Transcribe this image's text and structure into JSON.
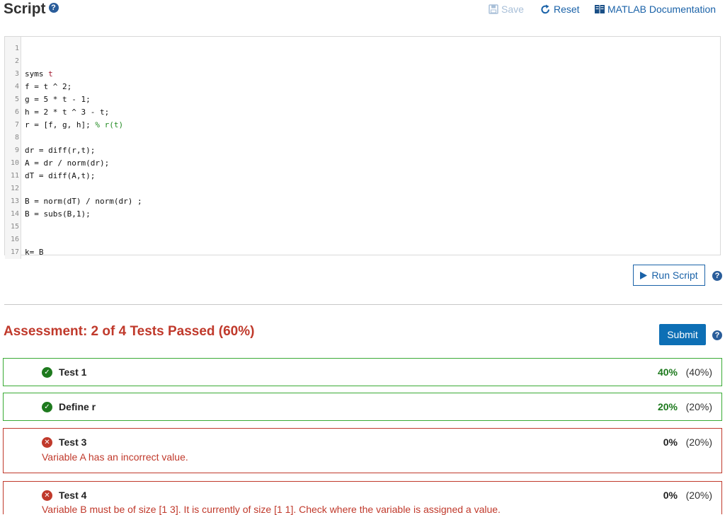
{
  "header": {
    "title": "Script",
    "save_label": "Save",
    "reset_label": "Reset",
    "docs_label": "MATLAB Documentation"
  },
  "editor": {
    "lines": [
      {
        "num": "1",
        "code": ""
      },
      {
        "num": "2",
        "code": ""
      },
      {
        "num": "3",
        "code": "syms t"
      },
      {
        "num": "4",
        "code": "f = t ^ 2;"
      },
      {
        "num": "5",
        "code": "g = 5 * t - 1;"
      },
      {
        "num": "6",
        "code": "h = 2 * t ^ 3 - t;"
      },
      {
        "num": "7",
        "code": "r = [f, g, h]; ",
        "comment": "% r(t)"
      },
      {
        "num": "8",
        "code": ""
      },
      {
        "num": "9",
        "code": "dr = diff(r,t);"
      },
      {
        "num": "10",
        "code": "A = dr / norm(dr);"
      },
      {
        "num": "11",
        "code": "dT = diff(A,t);"
      },
      {
        "num": "12",
        "code": ""
      },
      {
        "num": "13",
        "code": "B = norm(dT) / norm(dr) ;"
      },
      {
        "num": "14",
        "code": "B = subs(B,1);"
      },
      {
        "num": "15",
        "code": ""
      },
      {
        "num": "16",
        "code": ""
      },
      {
        "num": "17",
        "code": "k= B"
      }
    ]
  },
  "run": {
    "label": "Run Script"
  },
  "assessment": {
    "title": "Assessment: 2 of 4 Tests Passed (60%)",
    "submit_label": "Submit",
    "tests": [
      {
        "name": "Test 1",
        "score": "40%",
        "weight": "(40%)",
        "passed": true,
        "message": ""
      },
      {
        "name": "Define r",
        "score": "20%",
        "weight": "(20%)",
        "passed": true,
        "message": ""
      },
      {
        "name": "Test 3",
        "score": "0%",
        "weight": "(20%)",
        "passed": false,
        "message": "Variable A has an incorrect value."
      },
      {
        "name": "Test 4",
        "score": "0%",
        "weight": "(20%)",
        "passed": false,
        "message": "Variable B must be of size [1 3]. It is currently of size [1 1]. Check where the variable is assigned a value."
      }
    ]
  },
  "colors": {
    "accent": "#0d6fb5",
    "pass": "#3aaa35",
    "fail": "#c0392b"
  }
}
